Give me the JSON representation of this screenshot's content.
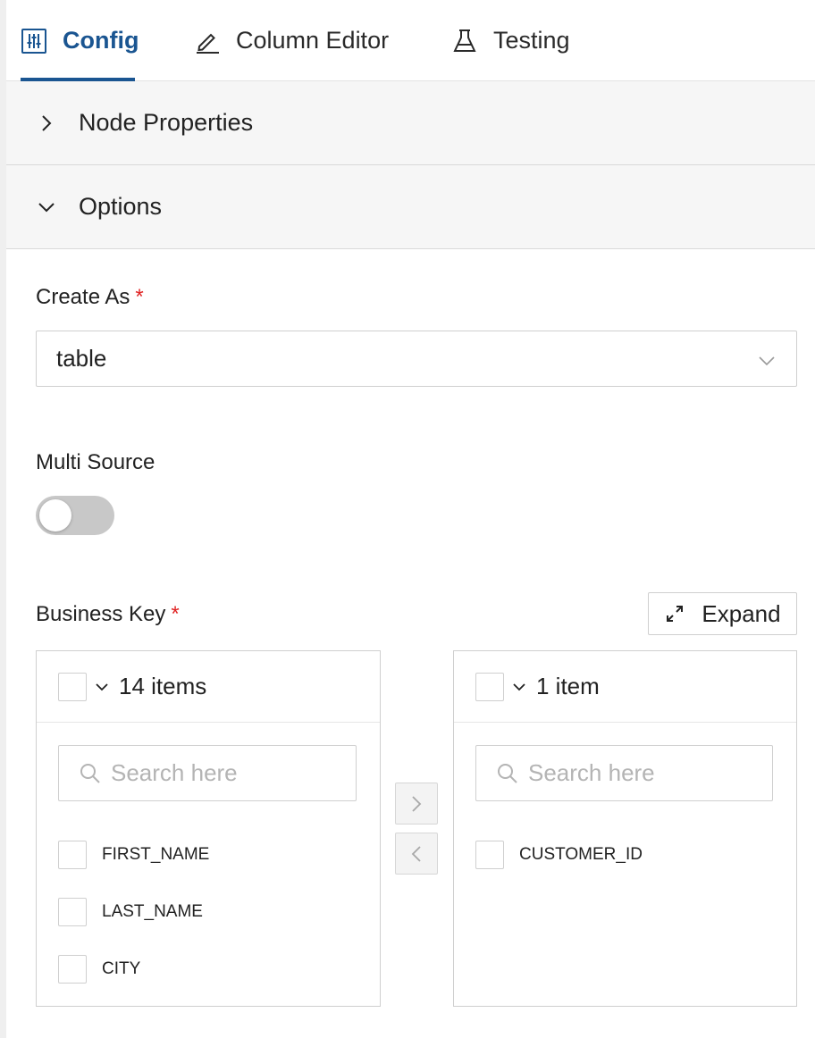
{
  "tabs": [
    {
      "label": "Config",
      "icon": "sliders-icon",
      "active": true
    },
    {
      "label": "Column Editor",
      "icon": "pencil-icon",
      "active": false
    },
    {
      "label": "Testing",
      "icon": "flask-icon",
      "active": false
    }
  ],
  "sections": {
    "node_properties": {
      "label": "Node Properties",
      "expanded": false
    },
    "options": {
      "label": "Options",
      "expanded": true
    }
  },
  "create_as": {
    "label": "Create As",
    "required_mark": "*",
    "value": "table"
  },
  "multi_source": {
    "label": "Multi Source",
    "enabled": false
  },
  "business_key": {
    "label": "Business Key",
    "required_mark": "*",
    "expand_label": "Expand",
    "source": {
      "count_label": "14 items",
      "search_placeholder": "Search here",
      "items": [
        "FIRST_NAME",
        "LAST_NAME",
        "CITY"
      ]
    },
    "target": {
      "count_label": "1 item",
      "search_placeholder": "Search here",
      "items": [
        "CUSTOMER_ID"
      ]
    }
  },
  "colors": {
    "accent": "#1a5591",
    "required": "#e02424",
    "toggle_off": "#c8c8c8"
  }
}
